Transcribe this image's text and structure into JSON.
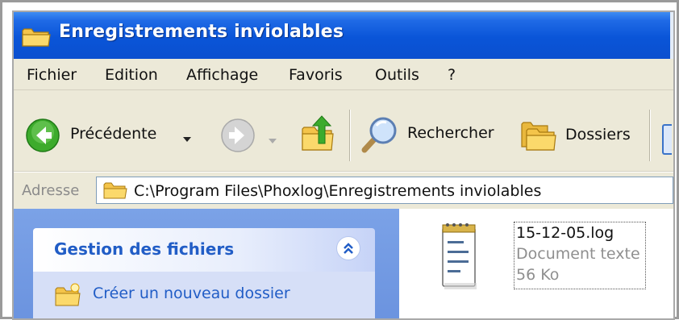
{
  "window": {
    "title": "Enregistrements inviolables",
    "title_icon": "folder-icon"
  },
  "menubar": {
    "items": [
      {
        "label": "Fichier"
      },
      {
        "label": "Edition"
      },
      {
        "label": "Affichage"
      },
      {
        "label": "Favoris"
      },
      {
        "label": "Outils"
      },
      {
        "label": "?"
      }
    ]
  },
  "toolbar": {
    "back_label": "Précédente",
    "back_icon": "back-arrow-icon",
    "forward_icon": "forward-arrow-icon",
    "up_icon": "folder-up-icon",
    "search_label": "Rechercher",
    "search_icon": "magnifier-icon",
    "folders_label": "Dossiers",
    "folders_icon": "folders-icon"
  },
  "address": {
    "label": "Adresse",
    "path": "C:\\Program Files\\Phoxlog\\Enregistrements inviolables"
  },
  "tasks": {
    "title": "Gestion des fichiers",
    "items": [
      {
        "label": "Créer un nouveau dossier",
        "icon": "new-folder-icon"
      }
    ]
  },
  "files": [
    {
      "name": "15-12-05.log",
      "type": "Document texte",
      "size": "56 Ko",
      "icon": "notepad-icon"
    }
  ],
  "colors": {
    "titlebar": "#0a55d8",
    "taskpane": "#7ba2e7",
    "task_link": "#215dc6",
    "chrome": "#ece9d8"
  }
}
